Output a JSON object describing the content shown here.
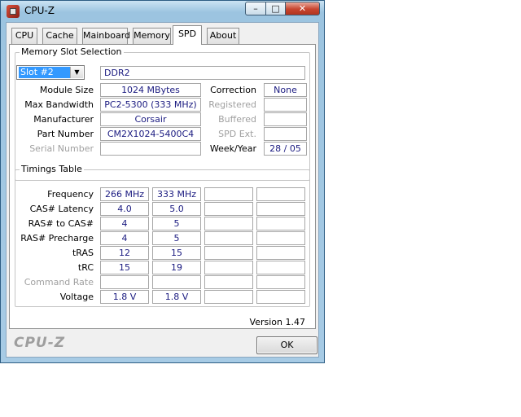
{
  "window": {
    "title": "CPU-Z",
    "min_glyph": "–",
    "max_glyph": "□",
    "close_glyph": "✕"
  },
  "tabs": [
    {
      "label": "CPU"
    },
    {
      "label": "Cache"
    },
    {
      "label": "Mainboard"
    },
    {
      "label": "Memory"
    },
    {
      "label": "SPD"
    },
    {
      "label": "About"
    }
  ],
  "active_tab": "SPD",
  "memory_slot": {
    "group_title": "Memory Slot Selection",
    "slot_selected": "Slot #2",
    "type": "DDR2",
    "module_size_label": "Module Size",
    "module_size": "1024 MBytes",
    "max_bandwidth_label": "Max Bandwidth",
    "max_bandwidth": "PC2-5300 (333 MHz)",
    "manufacturer_label": "Manufacturer",
    "manufacturer": "Corsair",
    "part_number_label": "Part Number",
    "part_number": "CM2X1024-5400C4",
    "serial_number_label": "Serial Number",
    "serial_number": "",
    "correction_label": "Correction",
    "correction": "None",
    "registered_label": "Registered",
    "registered": "",
    "buffered_label": "Buffered",
    "buffered": "",
    "spd_ext_label": "SPD Ext.",
    "spd_ext": "",
    "week_year_label": "Week/Year",
    "week_year": "28 / 05"
  },
  "timings": {
    "group_title": "Timings Table",
    "rows": [
      {
        "label": "Frequency",
        "values": [
          "266 MHz",
          "333 MHz",
          "",
          ""
        ],
        "dim": false
      },
      {
        "label": "CAS# Latency",
        "values": [
          "4.0",
          "5.0",
          "",
          ""
        ],
        "dim": false
      },
      {
        "label": "RAS# to CAS#",
        "values": [
          "4",
          "5",
          "",
          ""
        ],
        "dim": false
      },
      {
        "label": "RAS# Precharge",
        "values": [
          "4",
          "5",
          "",
          ""
        ],
        "dim": false
      },
      {
        "label": "tRAS",
        "values": [
          "12",
          "15",
          "",
          ""
        ],
        "dim": false
      },
      {
        "label": "tRC",
        "values": [
          "15",
          "19",
          "",
          ""
        ],
        "dim": false
      },
      {
        "label": "Command Rate",
        "values": [
          "",
          "",
          "",
          ""
        ],
        "dim": true
      },
      {
        "label": "Voltage",
        "values": [
          "1.8 V",
          "1.8 V",
          "",
          ""
        ],
        "dim": false
      }
    ]
  },
  "footer": {
    "version": "Version 1.47",
    "logo": "CPU-Z",
    "ok_label": "OK"
  }
}
